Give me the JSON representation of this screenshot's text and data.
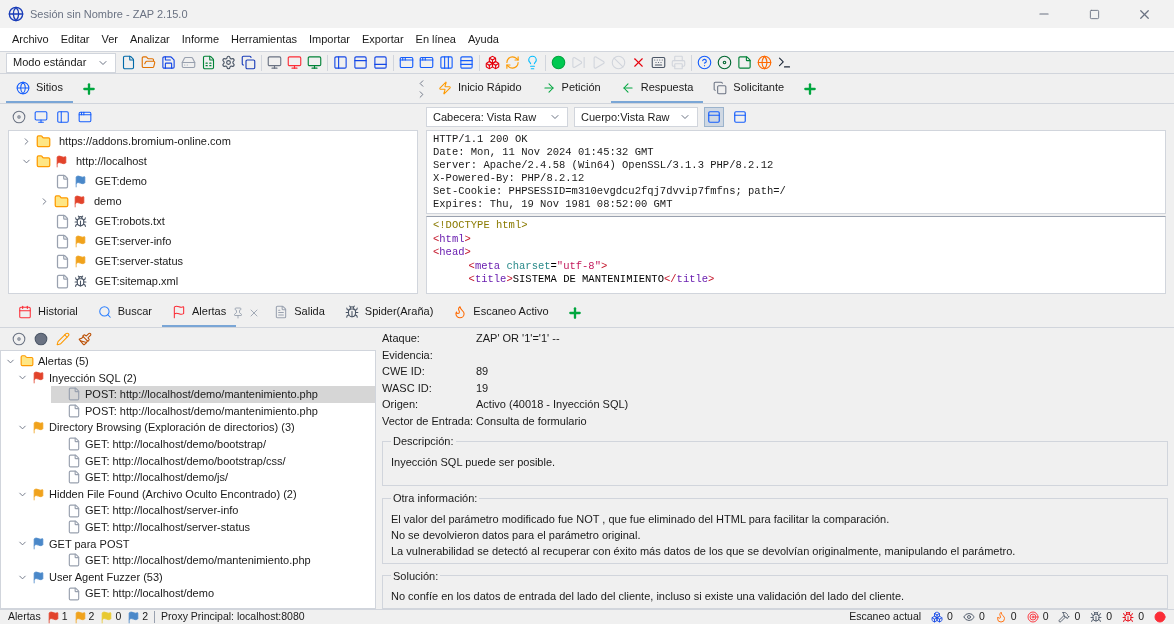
{
  "window": {
    "title": "Sesión sin Nombre - ZAP 2.15.0"
  },
  "menu": [
    "Archivo",
    "Editar",
    "Ver",
    "Analizar",
    "Informe",
    "Herramientas",
    "Importar",
    "Exportar",
    "En línea",
    "Ayuda"
  ],
  "mode_select": {
    "value": "Modo estándar"
  },
  "sites_tabs": [
    {
      "label": "Sitios",
      "selected": true
    }
  ],
  "work_tabs": [
    {
      "label": "Inicio Rápido",
      "selected": false
    },
    {
      "label": "Petición",
      "selected": false
    },
    {
      "label": "Respuesta",
      "selected": true
    },
    {
      "label": "Solicitante",
      "selected": false
    }
  ],
  "sites_tree": [
    {
      "label": "https://addons.bromium-online.com",
      "kind": "folder",
      "expanded": false
    },
    {
      "label": "http://localhost",
      "kind": "folder",
      "expanded": true,
      "color": "#e2432b",
      "children": [
        {
          "label": "GET:demo",
          "kind": "page",
          "color": "#4a88c9"
        },
        {
          "label": "demo",
          "kind": "folder",
          "expanded": false,
          "color": "#e2432b"
        },
        {
          "label": "GET:robots.txt",
          "kind": "page"
        },
        {
          "label": "GET:server-info",
          "kind": "page",
          "color": "#f0a21c"
        },
        {
          "label": "GET:server-status",
          "kind": "page",
          "color": "#f0a21c"
        },
        {
          "label": "GET:sitemap.xml",
          "kind": "page"
        }
      ]
    }
  ],
  "response": {
    "header_view": "Cabecera: Vista Raw",
    "body_view": "Cuerpo:Vista Raw",
    "layout_buttons": [
      {
        "selected": true
      },
      {
        "selected": false
      }
    ],
    "header_lines": [
      "HTTP/1.1 200 OK",
      "Date: Mon, 11 Nov 2024 01:45:32 GMT",
      "Server: Apache/2.4.58 (Win64) OpenSSL/3.1.3 PHP/8.2.12",
      "X-Powered-By: PHP/8.2.12",
      "Set-Cookie: PHPSESSID=m310evgdcu2fqj7dvvip7fmfns; path=/",
      "Expires: Thu, 19 Nov 1981 08:52:00 GMT"
    ],
    "body_lines": [
      {
        "tokens": [
          {
            "kind": "doctype",
            "text": "<!DOCTYPE html>"
          }
        ]
      },
      {
        "tokens": [
          {
            "kind": "punct",
            "text": "<"
          },
          {
            "kind": "tag",
            "text": "html"
          },
          {
            "kind": "punct",
            "text": ">"
          }
        ]
      },
      {
        "tokens": [
          {
            "kind": "punct",
            "text": "<"
          },
          {
            "kind": "tag",
            "text": "head"
          },
          {
            "kind": "punct",
            "text": ">"
          }
        ],
        "children": [
          {
            "tokens": [
              {
                "kind": "punct",
                "text": "<"
              },
              {
                "kind": "tag",
                "text": "meta"
              },
              {
                "kind": "attr",
                "text": "charset"
              },
              {
                "kind": "text",
                "text": "="
              },
              {
                "kind": "value",
                "text": "\"utf-8\""
              },
              {
                "kind": "punct",
                "text": ">"
              }
            ]
          },
          {
            "tokens": [
              {
                "kind": "punct",
                "text": "<"
              },
              {
                "kind": "tag",
                "text": "title"
              },
              {
                "kind": "punct",
                "text": ">"
              },
              {
                "kind": "text",
                "text": "SISTEMA DE MANTENIMIENTO"
              },
              {
                "kind": "punct",
                "text": "</"
              },
              {
                "kind": "tag",
                "text": "title"
              },
              {
                "kind": "punct",
                "text": ">"
              }
            ]
          }
        ]
      }
    ]
  },
  "bottom_tabs": [
    {
      "label": "Historial",
      "selected": false
    },
    {
      "label": "Buscar",
      "selected": false
    },
    {
      "label": "Alertas",
      "selected": true
    },
    {
      "label": "Salida",
      "selected": false
    },
    {
      "label": "Spider(Araña)",
      "selected": false
    },
    {
      "label": "Escaneo Activo",
      "selected": false
    }
  ],
  "alerts_tree": [
    {
      "label": "Alertas (5)",
      "kind": "folder",
      "expanded": true,
      "children": [
        {
          "label": "Inyección SQL (2)",
          "kind": "alert",
          "color": "#e2432b",
          "expanded": true,
          "children": [
            {
              "label": "POST: http://localhost/demo/mantenimiento.php",
              "kind": "page",
              "selected": true
            },
            {
              "label": "POST: http://localhost/demo/mantenimiento.php",
              "kind": "page",
              "selected": false
            }
          ]
        },
        {
          "label": "Directory Browsing (Exploración de directorios) (3)",
          "kind": "alert",
          "color": "#f0a21c",
          "expanded": true,
          "children": [
            {
              "label": "GET: http://localhost/demo/bootstrap/",
              "kind": "page",
              "selected": false
            },
            {
              "label": "GET: http://localhost/demo/bootstrap/css/",
              "kind": "page",
              "selected": false
            },
            {
              "label": "GET: http://localhost/demo/js/",
              "kind": "page",
              "selected": false
            }
          ]
        },
        {
          "label": "Hidden File Found (Archivo Oculto Encontrado) (2)",
          "kind": "alert",
          "color": "#f0a21c",
          "expanded": true,
          "children": [
            {
              "label": "GET: http://localhost/server-info",
              "kind": "page",
              "selected": false
            },
            {
              "label": "GET: http://localhost/server-status",
              "kind": "page",
              "selected": false
            }
          ]
        },
        {
          "label": "GET para POST",
          "kind": "alert",
          "color": "#4a88c9",
          "expanded": true,
          "children": [
            {
              "label": "GET: http://localhost/demo/mantenimiento.php",
              "kind": "page",
              "selected": false
            }
          ]
        },
        {
          "label": "User Agent Fuzzer (53)",
          "kind": "alert",
          "color": "#4a88c9",
          "expanded": true,
          "children": [
            {
              "label": "GET: http://localhost/demo",
              "kind": "page",
              "selected": false
            }
          ]
        }
      ]
    }
  ],
  "alert_details": {
    "fields": [
      {
        "label": "Ataque:",
        "value": "ZAP' OR '1'='1' --"
      },
      {
        "label": "Evidencia:"
      },
      {
        "label": "CWE ID:",
        "value": "89"
      },
      {
        "label": "WASC ID:",
        "value": "19"
      },
      {
        "label": "Origen:",
        "value": "Activo (40018 - Inyección SQL)"
      },
      {
        "label": "Vector de Entrada:",
        "value": "Consulta de formulario"
      }
    ],
    "sections": [
      {
        "title": "Descripción:",
        "lines": [
          "Inyección SQL puede ser posible."
        ]
      },
      {
        "title": "Otra información:",
        "lines": [
          "El valor del parámetro modificado fue NOT , que fue eliminado del HTML para facilitar la comparación.",
          "No se devolvieron datos para el parámetro original.",
          "La vulnerabilidad se detectó al recuperar con éxito más datos de los que se devolvían originalmente, manipulando el parámetro."
        ]
      },
      {
        "title": "Solución:",
        "lines": [
          "No confíe en los datos de entrada del lado del cliente, incluso si existe una validación del lado del cliente."
        ]
      }
    ]
  },
  "status_bar": {
    "alerts_label": "Alertas",
    "alert_counts": [
      {
        "count": "1",
        "color": "#e2432b"
      },
      {
        "count": "2",
        "color": "#f0a21c"
      },
      {
        "count": "0",
        "color": "#e8c930"
      },
      {
        "count": "2",
        "color": "#4a88c9"
      }
    ],
    "proxy": "Proxy Principal: localhost:8080",
    "scan_label": "Escaneo actual",
    "scan_counts": [
      "0",
      "0",
      "0",
      "0",
      "0",
      "0",
      "0"
    ]
  }
}
